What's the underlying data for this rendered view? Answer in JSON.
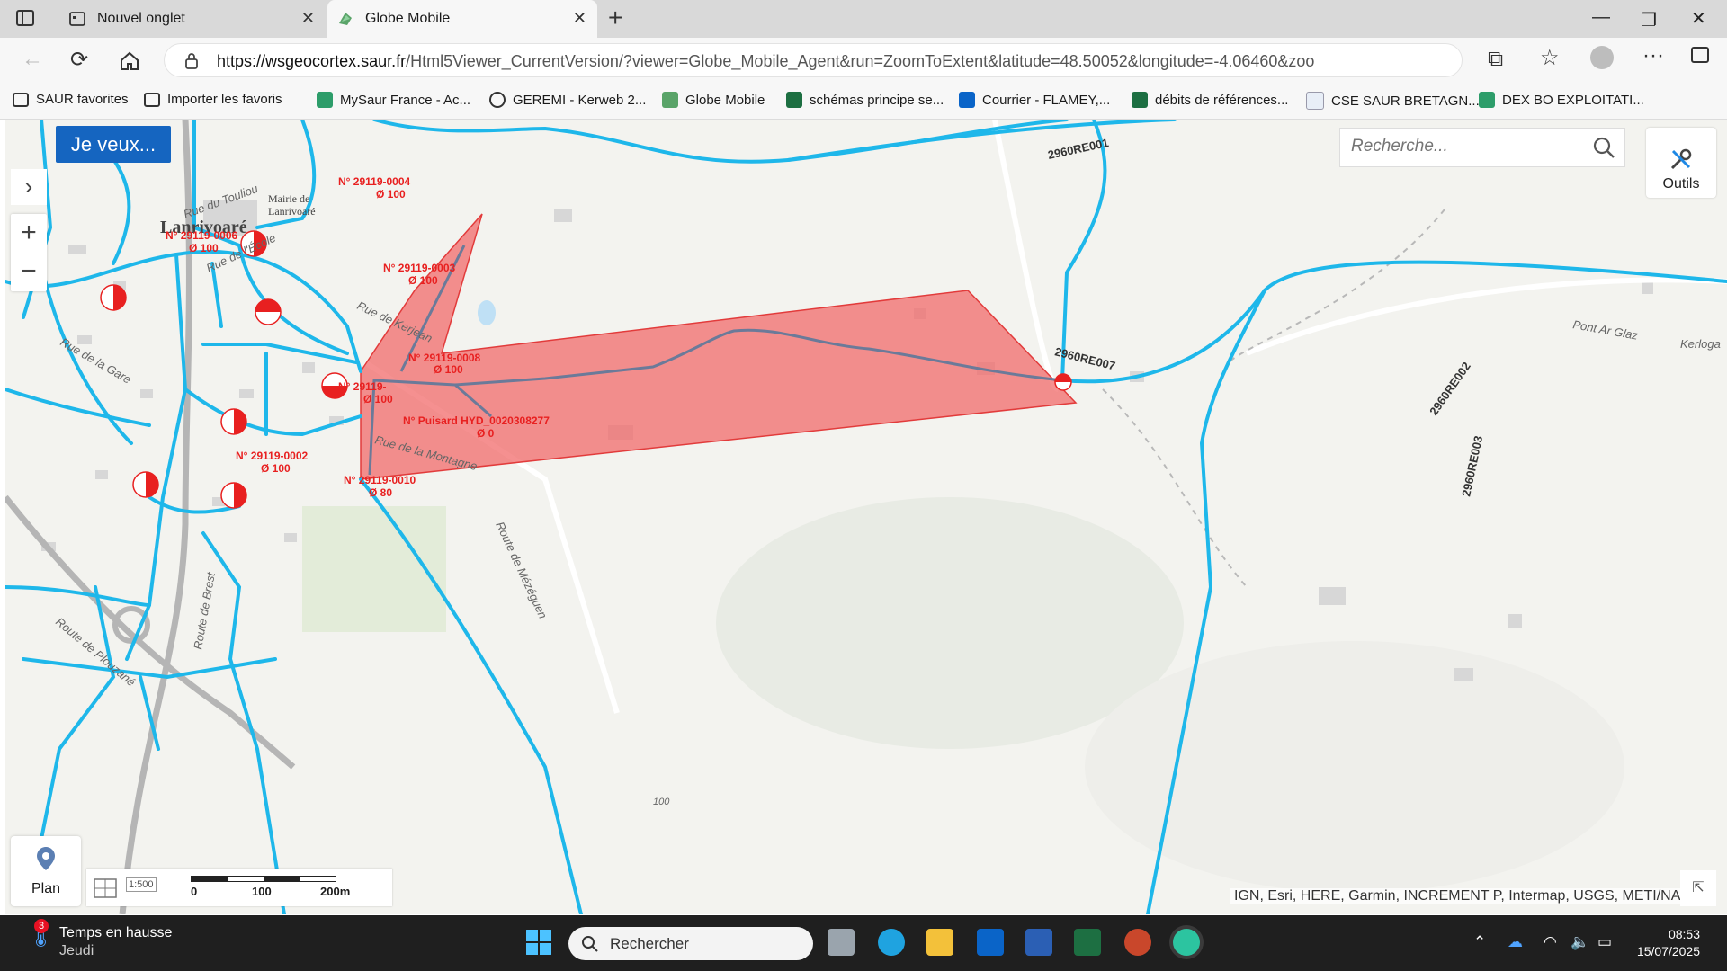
{
  "browser": {
    "tabs": [
      {
        "label": "Nouvel onglet",
        "active": false
      },
      {
        "label": "Globe Mobile",
        "active": true
      }
    ],
    "url": {
      "host": "https://wsgeocortex.saur.fr",
      "path": "/Html5Viewer_CurrentVersion/?viewer=Globe_Mobile_Agent&run=ZoomToExtent&latitude=48.50052&longitude=-4.06460&zoo..."
    },
    "bookmarks": [
      "SAUR favorites",
      "Importer les favoris",
      "MySaur France - Ac...",
      "GEREMI - Kerweb 2...",
      "Globe Mobile",
      "schémas principe se...",
      "Courrier - FLAMEY,...",
      "débits de références...",
      "CSE SAUR BRETAGN...",
      "DEX BO EXPLOITATI..."
    ]
  },
  "app": {
    "je_veux_label": "Je veux...",
    "search_placeholder": "Recherche...",
    "outils_label": "Outils",
    "plan_label": "Plan",
    "scale_ratio": "1:500",
    "scale_labels": [
      "0",
      "100",
      "200m"
    ],
    "attribution": "IGN, Esri, HERE, Garmin, INCREMENT P, Intermap, USGS, METI/NASA"
  },
  "map": {
    "town_name": "Lanrivoaré",
    "town_hall": [
      "Mairie de",
      "Lanrivoaré"
    ],
    "pipe_labels": [
      "2960RE001",
      "2960RE007",
      "2960RE002",
      "2960RE003"
    ],
    "hydrants": [
      {
        "id": "N° 29119-0004",
        "dia": "Ø 100"
      },
      {
        "id": "N° 29119-0006",
        "dia": "Ø 100"
      },
      {
        "id": "N° 29119-0003",
        "dia": "Ø 100"
      },
      {
        "id": "N° 29119-0008",
        "dia": "Ø 100"
      },
      {
        "id": "N° 29119-",
        "dia": "Ø 100"
      },
      {
        "id": "N° Puisard  HYD_0020308277",
        "dia": "Ø 0"
      },
      {
        "id": "N° 29119-0002",
        "dia": "Ø 100"
      },
      {
        "id": "N° 29119-0010",
        "dia": "Ø 80"
      }
    ],
    "street_names": [
      "Rue de l'École",
      "Rue de Kerjean",
      "Rue de la Gare",
      "Route de Mézéguen",
      "Rue de la Montagne",
      "Route de Brest",
      "Route de Plouzané",
      "Pont Ar Glaz",
      "Kerloga",
      "Rue du Touliou"
    ],
    "contour": "100",
    "colors": {
      "pipe": "#1eb7ea",
      "selection": "#f26b6b",
      "hydrant": "#e82020"
    }
  },
  "taskbar": {
    "weather_title": "Temps en hausse",
    "weather_sub": "Jeudi",
    "weather_badge": "3",
    "search_label": "Rechercher",
    "time": "08:53",
    "date": "15/07/2025"
  }
}
